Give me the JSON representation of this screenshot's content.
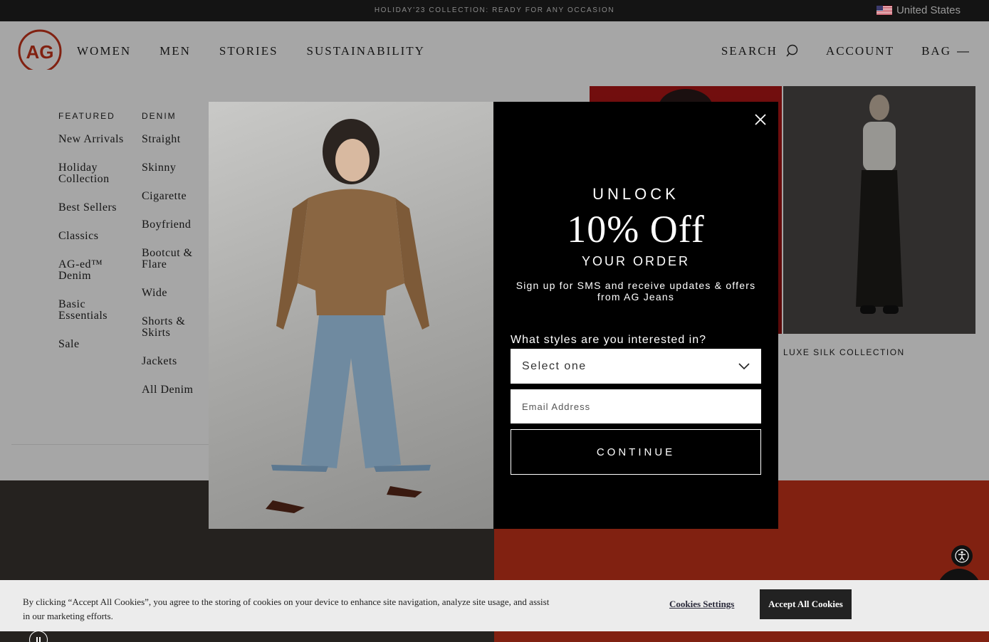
{
  "promo": {
    "text": "HOLIDAY'23 COLLECTION: READY FOR ANY OCCASION",
    "region": "United States",
    "region_icon": "us-flag-icon"
  },
  "header": {
    "logo_text": "AG",
    "nav": [
      "WOMEN",
      "MEN",
      "STORIES",
      "SUSTAINABILITY"
    ],
    "search_label": "SEARCH",
    "account_label": "ACCOUNT",
    "bag_label": "BAG",
    "bag_indicator": "—"
  },
  "menu": {
    "featured": {
      "heading": "FEATURED",
      "items": [
        "New Arrivals",
        "Holiday Collection",
        "Best Sellers",
        "Classics",
        "AG-ed™ Denim",
        "Basic Essentials",
        "Sale"
      ]
    },
    "denim": {
      "heading": "DENIM",
      "items": [
        "Straight",
        "Skinny",
        "Cigarette",
        "Boyfriend",
        "Bootcut & Flare",
        "Wide",
        "Shorts & Skirts",
        "Jackets",
        "All Denim"
      ]
    },
    "feature_caption": "LUXE SILK COLLECTION"
  },
  "modal": {
    "eyebrow": "UNLOCK",
    "headline": "10% Off",
    "subhead": "YOUR ORDER",
    "description": "Sign up for SMS and receive updates & offers from AG Jeans",
    "question": "What styles are you interested in?",
    "select_value": "Select one",
    "email_placeholder": "Email Address",
    "cta": "CONTINUE"
  },
  "cookie": {
    "text": "By clicking “Accept All Cookies”, you agree to the storing of cookies on your device to enhance site navigation, analyze site usage, and assist in our marketing efforts.",
    "settings_label": "Cookies Settings",
    "accept_label": "Accept All Cookies"
  },
  "colors": {
    "accent_red": "#c7331b",
    "promo_bg": "#141414",
    "modal_bg": "#000000"
  }
}
